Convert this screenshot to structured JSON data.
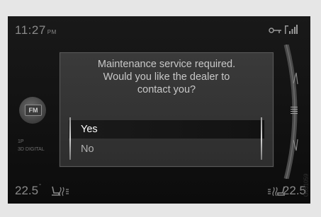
{
  "status_bar": {
    "time": "11:27",
    "ampm": "PM",
    "key_icon": "key-icon",
    "signal_icon": "signal-icon"
  },
  "radio": {
    "band": "FM",
    "preset": "1P",
    "station": "3D DIGITAL"
  },
  "dialog": {
    "message_lines": [
      "Maintenance service required.",
      "Would you like the dealer to",
      "contact you?"
    ],
    "options": [
      {
        "label": "Yes",
        "selected": true
      },
      {
        "label": "No",
        "selected": false
      }
    ]
  },
  "climate": {
    "temp_left": "22.5",
    "temp_right": "22.5",
    "deg_symbol": "°",
    "seat_heat_icon": "seat-heating-icon"
  },
  "image_code": "G051059",
  "colors": {
    "screen_bg": "#151515",
    "dialog_bg": "#333333",
    "selection_bg": "#141414",
    "text_primary": "#ffffff",
    "text_dim": "#b0b0b0"
  }
}
